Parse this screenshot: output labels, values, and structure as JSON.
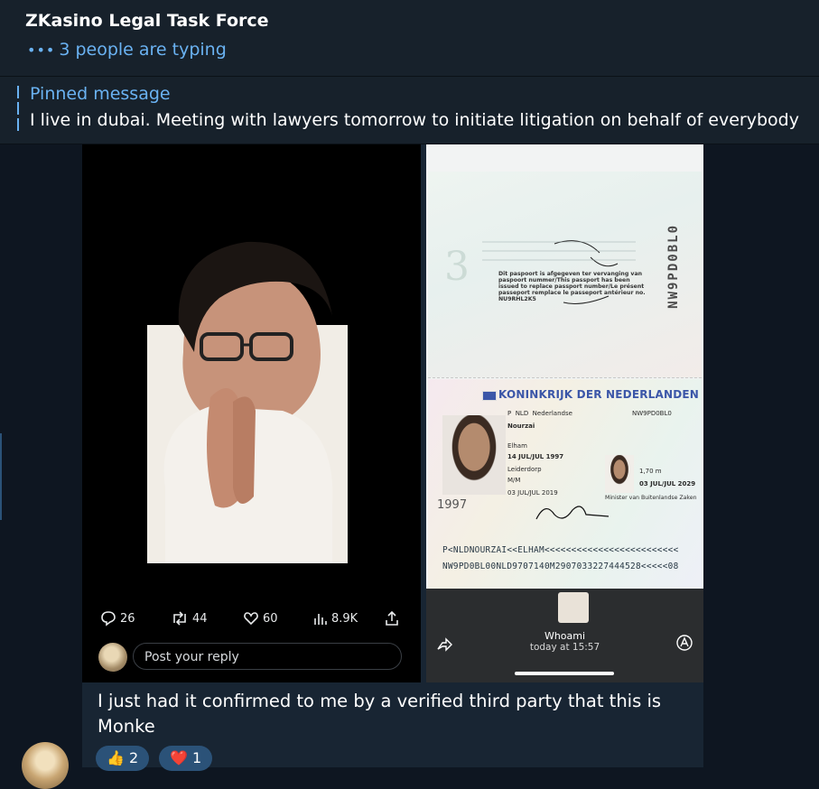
{
  "header": {
    "title": "ZKasino Legal Task Force",
    "typing_status": "3 people are typing"
  },
  "pinned": {
    "label": "Pinned message",
    "text": "I live in dubai. Meeting with lawyers tomorrow to initiate litigation on behalf of everybody"
  },
  "tweet": {
    "stats": {
      "replies": "26",
      "retweets": "44",
      "likes": "60",
      "views": "8.9K"
    },
    "reply_placeholder": "Post your reply"
  },
  "passport": {
    "side_number": "NW9PD0BL0",
    "endorsement_text": "Dit paspoort is afgegeven ter vervanging van paspoort nummer/This passport has been issued to replace passport number/Le présent passeport remplace le passeport antérieur no. NU9RHL2K5",
    "header": "KONINKRIJK DER NEDERLANDEN",
    "type_label": "P",
    "country_code": "NLD",
    "nationality": "Nederlandse",
    "passport_number": "NW9PD0BL0",
    "surname": "Nourzai",
    "given_name": "Elham",
    "birth_date": "14 JUL/JUL 1997",
    "birth_place": "Leiderdorp",
    "sex": "M/M",
    "issue_date": "03 JUL/JUL 2019",
    "height": "1,70 m",
    "expiry_date": "03 JUL/JUL 2029",
    "authority": "Minister van Buitenlandse Zaken",
    "watermark_year": "1997",
    "mrz_line1": "P<NLDNOURZAI<<ELHAM<<<<<<<<<<<<<<<<<<<<<<<<<",
    "mrz_line2": "NW9PD0BL00NLD9707140M2907033227444528<<<<<08"
  },
  "phone_overlay": {
    "sender": "Whoami",
    "time": "today at 15:57"
  },
  "message": {
    "text": "I just had it confirmed to me by a verified third party that this is Monke"
  },
  "reactions": [
    {
      "emoji": "👍",
      "count": "2"
    },
    {
      "emoji": "❤️",
      "count": "1"
    }
  ],
  "colors": {
    "background": "#0e1621",
    "header_bg": "#17212b",
    "accent": "#6ab2f2",
    "bubble": "#182533"
  }
}
